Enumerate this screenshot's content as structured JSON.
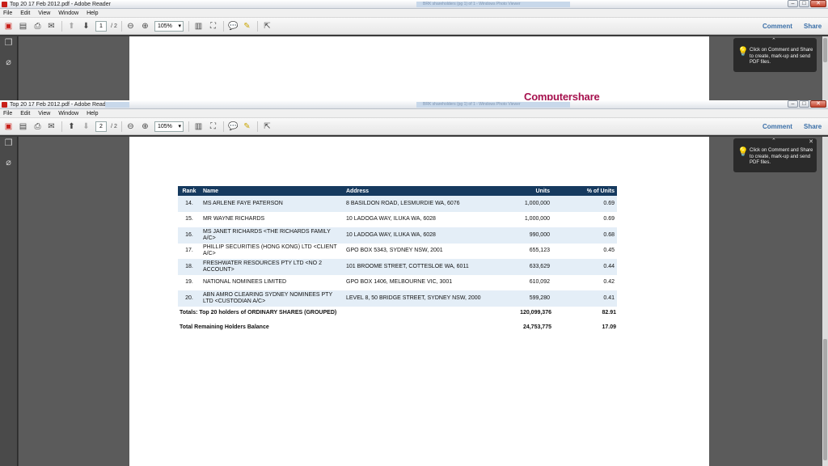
{
  "windows": [
    {
      "title": "Top 20 17 Feb 2012.pdf - Adobe Reader",
      "faint_title": "BRK shareholders (pg 1) of 1 - Windows Photo Viewer",
      "page_current": "1",
      "page_total": "/ 2",
      "zoom": "105%"
    },
    {
      "title": "Top 20 17 Feb 2012.pdf - Adobe Reader",
      "faint_title": "BRK shareholders (pg 1) of 1 - Windows Photo Viewer",
      "page_current": "2",
      "page_total": "/ 2",
      "zoom": "105%"
    }
  ],
  "menu": [
    "File",
    "Edit",
    "View",
    "Window",
    "Help"
  ],
  "toolbar_links": {
    "comment": "Comment",
    "share": "Share"
  },
  "tip_text": "Click on Comment and Share to create, mark-up and send PDF files.",
  "logo": "Computershare",
  "table": {
    "headers": [
      "Rank",
      "Name",
      "Address",
      "Units",
      "% of Units"
    ],
    "rows": [
      {
        "rank": "14.",
        "name": "MS ARLENE FAYE PATERSON",
        "address": "8 BASILDON ROAD, LESMURDIE WA, 6076",
        "units": "1,000,000",
        "pct": "0.69"
      },
      {
        "rank": "15.",
        "name": "MR WAYNE RICHARDS",
        "address": "10 LADOGA WAY, ILUKA WA, 6028",
        "units": "1,000,000",
        "pct": "0.69"
      },
      {
        "rank": "16.",
        "name": "MS JANET RICHARDS <THE RICHARDS FAMILY A/C>",
        "address": "10 LADOGA WAY, ILUKA WA, 6028",
        "units": "990,000",
        "pct": "0.68"
      },
      {
        "rank": "17.",
        "name": "PHILLIP SECURITIES (HONG KONG) LTD <CLIENT A/C>",
        "address": "GPO BOX 5343, SYDNEY NSW, 2001",
        "units": "655,123",
        "pct": "0.45"
      },
      {
        "rank": "18.",
        "name": "FRESHWATER RESOURCES PTY LTD <NO 2 ACCOUNT>",
        "address": "101 BROOME STREET, COTTESLOE WA, 6011",
        "units": "633,629",
        "pct": "0.44"
      },
      {
        "rank": "19.",
        "name": "NATIONAL NOMINEES LIMITED",
        "address": "GPO BOX 1406, MELBOURNE VIC, 3001",
        "units": "610,092",
        "pct": "0.42"
      },
      {
        "rank": "20.",
        "name": "ABN AMRO CLEARING SYDNEY NOMINEES PTY LTD <CUSTODIAN A/C>",
        "address": "LEVEL 8, 50 BRIDGE STREET, SYDNEY NSW, 2000",
        "units": "599,280",
        "pct": "0.41"
      }
    ]
  },
  "totals": {
    "label": "Totals: Top 20 holders of ORDINARY SHARES (GROUPED)",
    "units": "120,099,376",
    "pct": "82.91"
  },
  "remaining": {
    "label": "Total Remaining Holders Balance",
    "units": "24,753,775",
    "pct": "17.09"
  }
}
